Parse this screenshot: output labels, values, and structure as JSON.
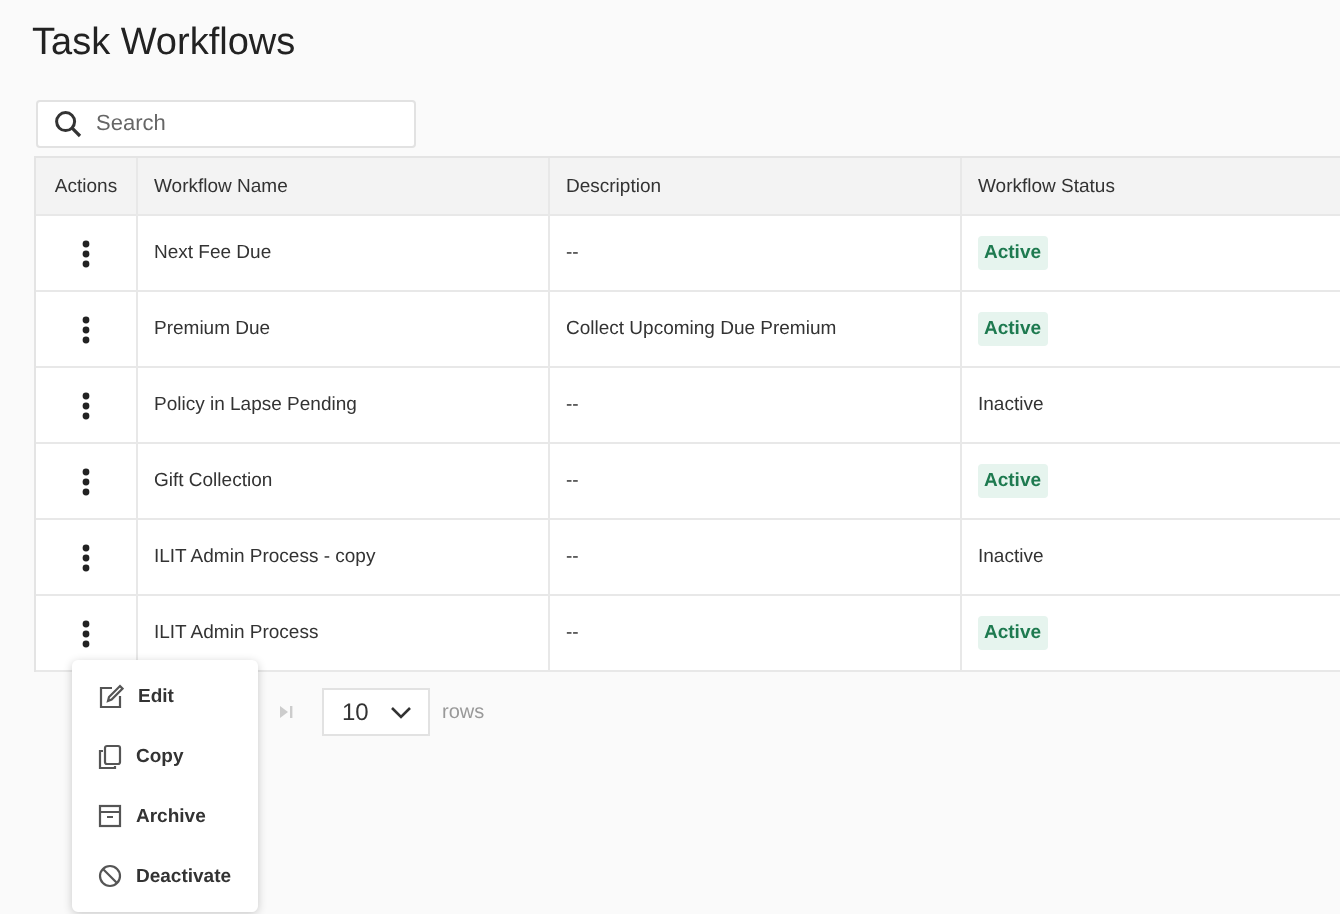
{
  "title": "Task Workflows",
  "search": {
    "placeholder": "Search"
  },
  "table": {
    "columns": [
      "Actions",
      "Workflow Name",
      "Description",
      "Workflow Status"
    ],
    "rows": [
      {
        "name": "Next Fee Due",
        "description": "--",
        "status": "Active",
        "active": true
      },
      {
        "name": "Premium Due",
        "description": "Collect Upcoming Due Premium",
        "status": "Active",
        "active": true
      },
      {
        "name": "Policy in Lapse Pending",
        "description": "--",
        "status": "Inactive",
        "active": false
      },
      {
        "name": "Gift Collection",
        "description": "--",
        "status": "Active",
        "active": true
      },
      {
        "name": "ILIT Admin Process - copy",
        "description": "--",
        "status": "Inactive",
        "active": false
      },
      {
        "name": "ILIT Admin Process",
        "description": "--",
        "status": "Active",
        "active": true
      }
    ]
  },
  "pagination": {
    "page_size": "10",
    "rows_label": "rows"
  },
  "action_menu": {
    "items": [
      {
        "kind": "edit",
        "label": "Edit"
      },
      {
        "kind": "copy",
        "label": "Copy"
      },
      {
        "kind": "archive",
        "label": "Archive"
      },
      {
        "kind": "deactivate",
        "label": "Deactivate"
      }
    ]
  }
}
